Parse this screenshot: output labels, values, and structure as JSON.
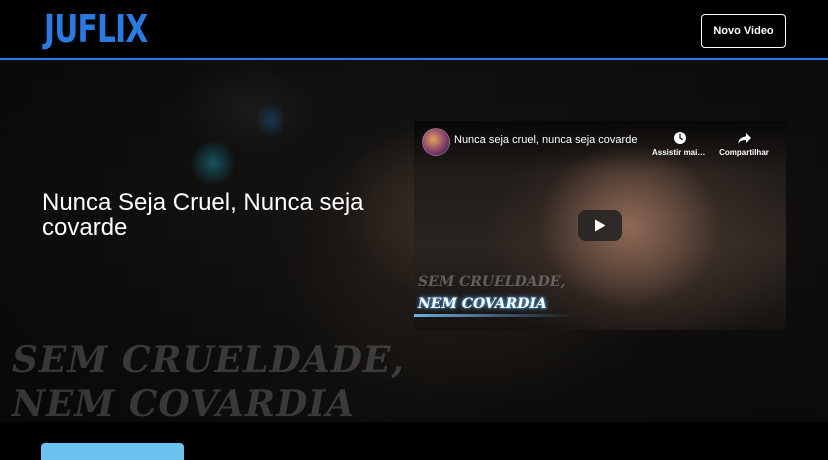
{
  "header": {
    "logo_text": "JUFLIX",
    "new_video_button": "Novo Video"
  },
  "banner": {
    "title": "Nunca Seja Cruel, Nunca seja covarde",
    "background_caption_line1": "SEM CRUELDADE,",
    "background_caption_line2": "NEM COVARDIA"
  },
  "video": {
    "title": "Nunca seja cruel, nunca seja covarde",
    "watch_later_label": "Assistir mais tarde",
    "share_label": "Compartilhar",
    "caption_line1": "SEM CRUELDADE,",
    "caption_line2": "NEM COVARDIA"
  },
  "colors": {
    "brand": "#2a7ae2",
    "category_accent": "#6cc3f0",
    "background": "#000000"
  },
  "icons": {
    "watch_later": "clock-icon",
    "share": "share-arrow-icon",
    "play": "play-icon"
  }
}
